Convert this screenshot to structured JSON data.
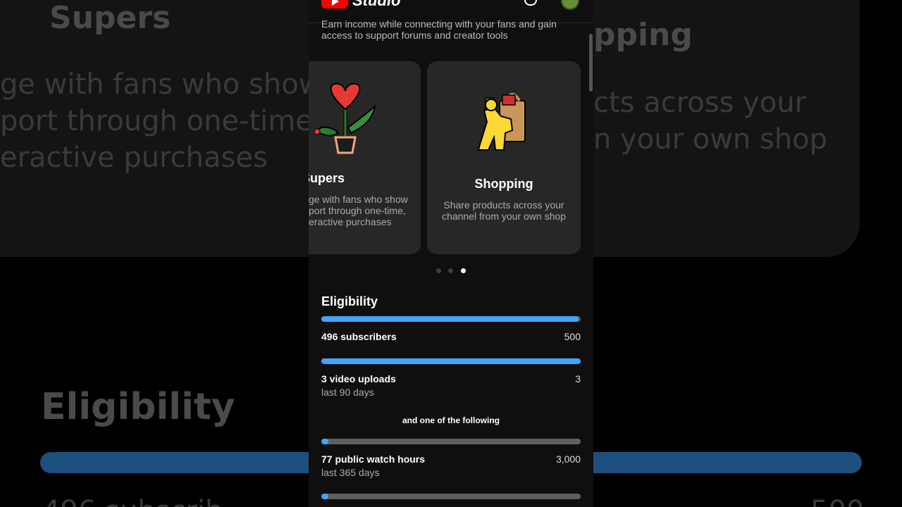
{
  "app": {
    "title": "Studio"
  },
  "intro_text": "Earn income while connecting with your fans and gain access to support forums and creator tools",
  "cards": [
    {
      "title": "Supers",
      "description": "Engage with fans who show support through one-time, interactive purchases",
      "desc_visible": "ge with fans who show\nport through one-time,\neractive purchases",
      "icon": "heart-plant-icon"
    },
    {
      "title": "Shopping",
      "description": "Share products across your channel from your own shop",
      "icon": "shopping-bag-icon"
    }
  ],
  "pagination": {
    "count": 3,
    "active": 2
  },
  "eligibility": {
    "title": "Eligibility",
    "or_text": "and one of the following",
    "requirements": [
      {
        "label": "496 subscribers",
        "sublabel": "",
        "target": "500",
        "progress": 0.992
      },
      {
        "label": "3 video uploads",
        "sublabel": "last 90 days",
        "target": "3",
        "progress": 1.0
      },
      {
        "label": "77 public watch hours",
        "sublabel": "last 365 days",
        "target": "3,000",
        "progress": 0.026
      },
      {
        "label": "",
        "sublabel": "",
        "target": "",
        "progress": 0.026
      }
    ]
  },
  "background": {
    "supers_title": "Supers",
    "shopping_title": "pping",
    "supers_lines": [
      "ge with fans who show",
      "port through one-time,",
      "eractive purchases"
    ],
    "shopping_lines": [
      "cts across your",
      "n your own shop"
    ],
    "eligibility_title": "Eligibility",
    "bottom_left": "496 subscrib",
    "bottom_right": "500"
  },
  "colors": {
    "accent": "#3ea6ff",
    "brand": "#ff0000",
    "track": "#5f5f5f"
  }
}
